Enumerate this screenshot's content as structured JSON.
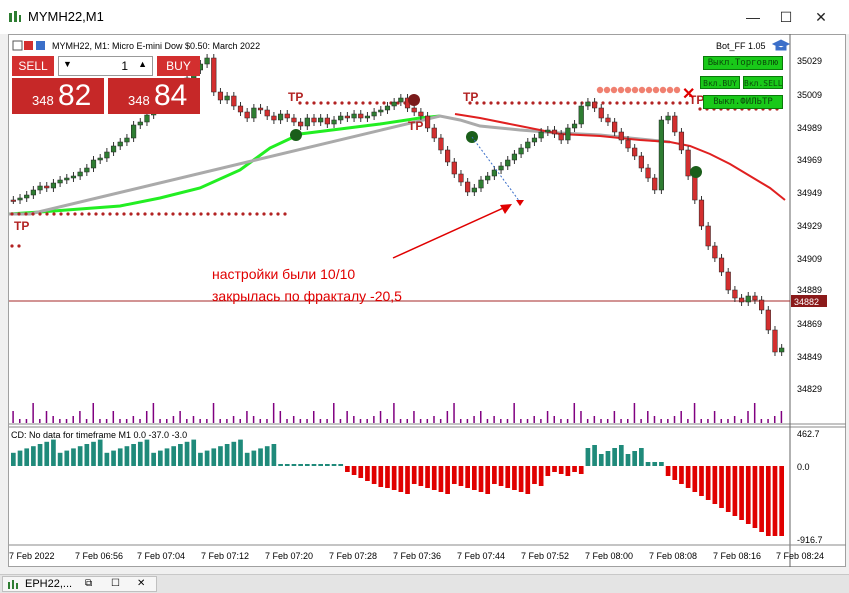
{
  "window": {
    "title": "MYMH22,M1",
    "minimize": "—",
    "maximize": "☐",
    "close": "✕"
  },
  "chart": {
    "header": "MYMH22, M1:  Micro E-mini Dow $0.50: March 2022",
    "bot_label": "Bot_FF 1.05",
    "current_price_tag": "34882",
    "price_labels": [
      "35029",
      "35009",
      "34989",
      "34969",
      "34949",
      "34929",
      "34909",
      "34889",
      "34869",
      "34849",
      "34829"
    ],
    "time_labels": [
      "7 Feb 2022",
      "7 Feb 06:56",
      "7 Feb 07:04",
      "7 Feb 07:12",
      "7 Feb 07:20",
      "7 Feb 07:28",
      "7 Feb 07:36",
      "7 Feb 07:44",
      "7 Feb 07:52",
      "7 Feb 08:00",
      "7 Feb 08:08",
      "7 Feb 08:16",
      "7 Feb 08:24"
    ],
    "tp_labels": [
      "TP",
      "TP",
      "TP",
      "TP",
      "TP"
    ],
    "annotation_line1": "настройки были 10/10",
    "annotation_line2": "закрылась по фракталу -20,5",
    "colors": {
      "bull": "#2e7d32",
      "bear": "#d32f2f",
      "ma_up": "#22ee22",
      "ma_down": "#e02020",
      "ma_flat": "#aaaaaa",
      "volume": "#800080",
      "cd_pos": "#1f8a7a",
      "cd_neg": "#e00000"
    }
  },
  "trade_panel": {
    "sell_label": "SELL",
    "buy_label": "BUY",
    "quantity": "1",
    "sell_price_small": "348",
    "sell_price_big": "82",
    "buy_price_small": "348",
    "buy_price_big": "84"
  },
  "bot_buttons": [
    "Выкл.Торговлю",
    "Вкл.BUY",
    "Вкл.SELL",
    "Выкл.ФИЛЬТР"
  ],
  "indicator": {
    "header": "CD: No data for timeframe M1 0.0 -37.0 -3.0",
    "scale_top": "462.7",
    "scale_mid": "0.0",
    "scale_bottom": "-916.7"
  },
  "taskbar": {
    "tab_label": "EPH22,..."
  }
}
